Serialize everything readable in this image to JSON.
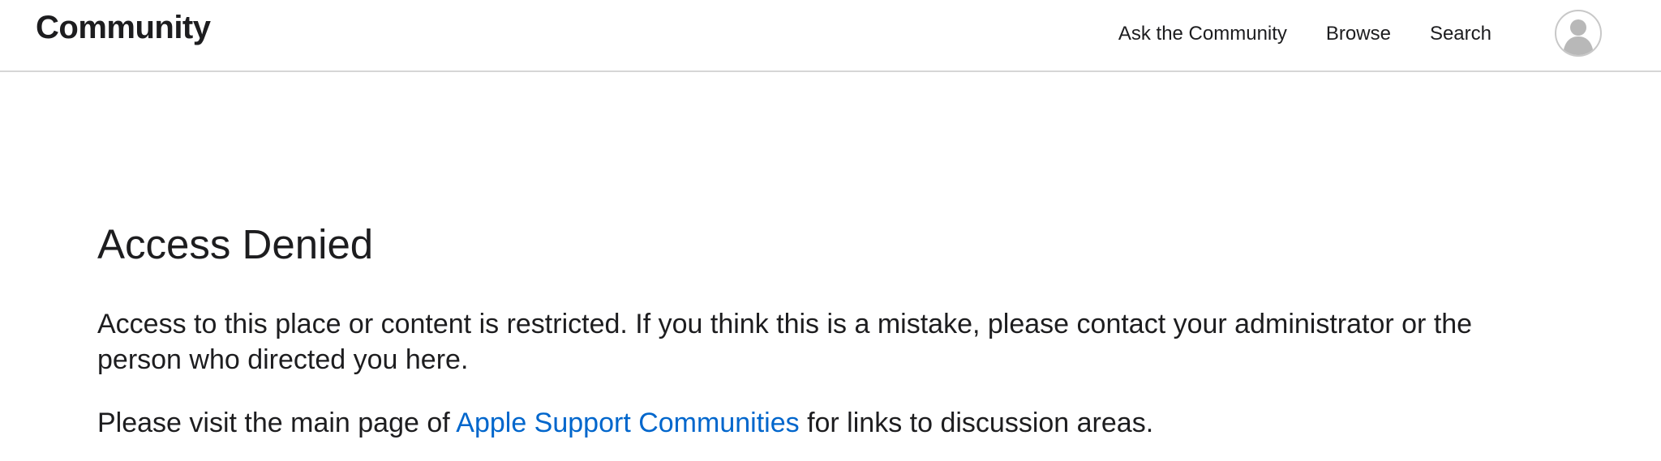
{
  "header": {
    "brand": "Community",
    "nav": {
      "ask": "Ask the Community",
      "browse": "Browse",
      "search": "Search"
    },
    "avatar_icon": "user-avatar-icon"
  },
  "main": {
    "title": "Access Denied",
    "message": "Access to this place or content is restricted. If you think this is a mistake, please contact your administrator or the person who directed you here.",
    "visit_prefix": "Please visit the main page of",
    "visit_link": "Apple Support Communities",
    "visit_suffix": "for links to discussion areas."
  },
  "colors": {
    "link": "#0066cc",
    "text": "#1d1d1f",
    "divider": "#d6d6d6"
  }
}
